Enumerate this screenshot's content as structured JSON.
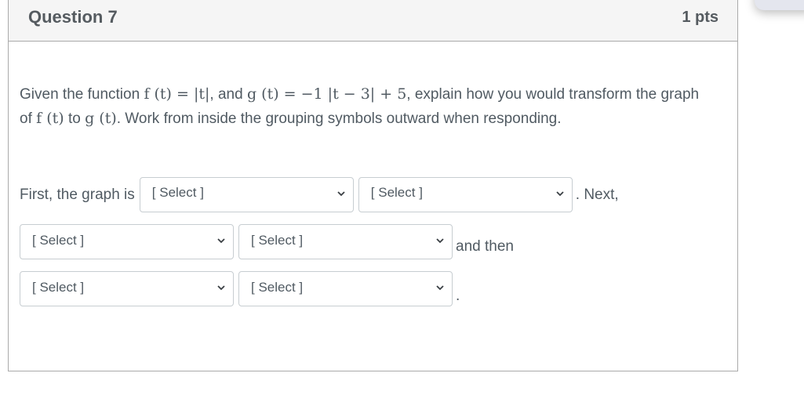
{
  "question": {
    "title": "Question 7",
    "points": "1 pts",
    "prompt": {
      "part1": "Given the function ",
      "f_def": "f (t) = |t|",
      "part2": ", and ",
      "g_def": "g (t) =  −1 |t − 3| + 5",
      "part3": ", explain how you would transform the graph of ",
      "f_ref": "f (t)",
      "part4": " to ",
      "g_ref": "g (t)",
      "part5": ". Work from inside the grouping symbols outward when responding."
    },
    "answer": {
      "row1_prefix": "First, the graph is",
      "row1_suffix": ". Next,",
      "row2_suffix": "and then",
      "row3_suffix": ".",
      "selects": [
        {
          "value": "[ Select ]"
        },
        {
          "value": "[ Select ]"
        },
        {
          "value": "[ Select ]"
        },
        {
          "value": "[ Select ]"
        },
        {
          "value": "[ Select ]"
        },
        {
          "value": "[ Select ]"
        }
      ]
    }
  },
  "colors": {
    "header_bg": "#f5f5f5",
    "border": "#aaaaaa",
    "text": "#505a62",
    "accent": "#9b5cf2"
  }
}
